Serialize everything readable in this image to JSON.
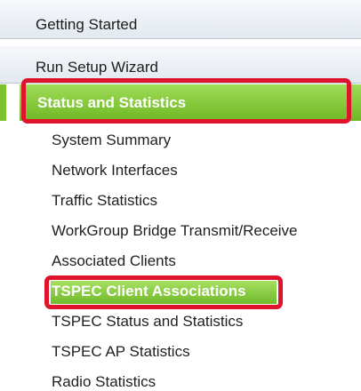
{
  "nav": {
    "getting_started": "Getting Started",
    "run_setup_wizard": "Run Setup Wizard",
    "status_and_statistics": "Status and Statistics",
    "items": [
      "System Summary",
      "Network Interfaces",
      "Traffic Statistics",
      "WorkGroup Bridge Transmit/Receive",
      "Associated Clients",
      "TSPEC Client Associations",
      "TSPEC Status and Statistics",
      "TSPEC AP Statistics",
      "Radio Statistics"
    ]
  },
  "colors": {
    "accent_green": "#7cc22f",
    "highlight_red": "#e0132c"
  }
}
